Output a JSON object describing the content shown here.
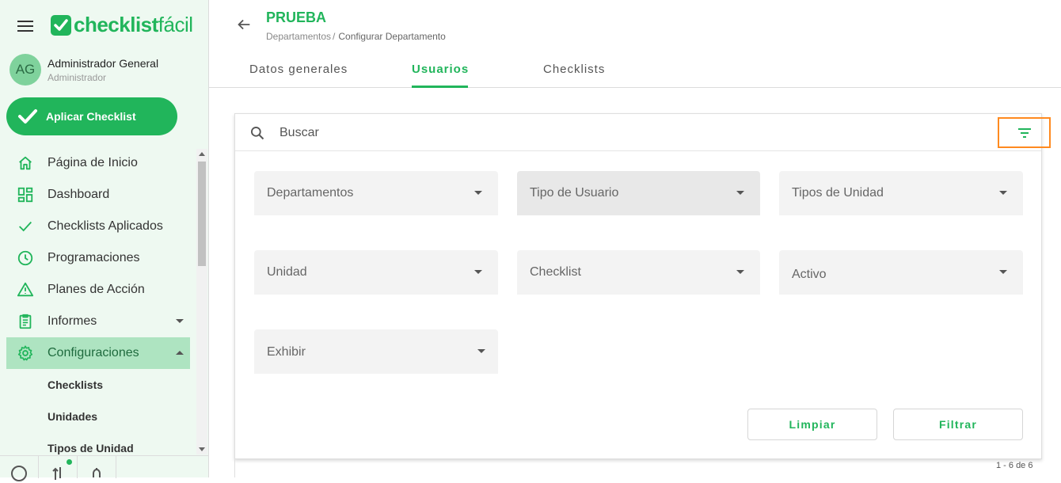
{
  "brand": {
    "logo_bold": "checklist",
    "logo_light": "fácil",
    "accent_color": "#21b55b"
  },
  "user": {
    "initials": "AG",
    "name": "Administrador General",
    "role": "Administrador"
  },
  "sidebar": {
    "apply_button": "Aplicar Checklist",
    "items": [
      {
        "label": "Página de Inicio",
        "icon": "home-icon"
      },
      {
        "label": "Dashboard",
        "icon": "dashboard-icon"
      },
      {
        "label": "Checklists Aplicados",
        "icon": "check-icon"
      },
      {
        "label": "Programaciones",
        "icon": "clock-icon"
      },
      {
        "label": "Planes de Acción",
        "icon": "warning-icon"
      },
      {
        "label": "Informes",
        "icon": "report-icon"
      },
      {
        "label": "Configuraciones",
        "icon": "gear-icon"
      }
    ],
    "sub_items": [
      {
        "label": "Checklists"
      },
      {
        "label": "Unidades"
      },
      {
        "label": "Tipos de Unidad"
      }
    ]
  },
  "header": {
    "title": "PRUEBA",
    "breadcrumb_parent": "Departamentos",
    "breadcrumb_sep": "/",
    "breadcrumb_current": "Configurar Departamento"
  },
  "tabs": [
    {
      "label": "Datos generales"
    },
    {
      "label": "Usuarios"
    },
    {
      "label": "Checklists"
    }
  ],
  "filters": {
    "search_placeholder": "Buscar",
    "selects": [
      {
        "label": "Departamentos"
      },
      {
        "label": "Tipo de Usuario"
      },
      {
        "label": "Tipos de Unidad"
      },
      {
        "label": "Unidad"
      },
      {
        "label": "Checklist"
      },
      {
        "label": "Activo"
      },
      {
        "label": "Exhibir"
      }
    ],
    "clear_button": "Limpiar",
    "filter_button": "Filtrar"
  },
  "pagination": "1 - 6 de 6"
}
